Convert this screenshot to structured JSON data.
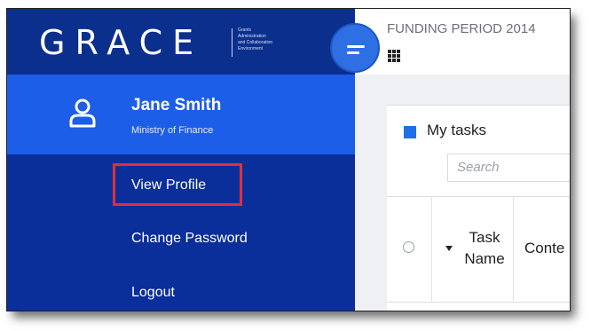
{
  "brand": {
    "name": "GRACE",
    "tagline": "Grants\nAdministration\nand Collaboration\nEnvironment"
  },
  "header": {
    "funding_period": "FUNDING PERIOD 2014",
    "menu_icon": "hamburger-icon",
    "apps_icon": "grid-icon"
  },
  "user": {
    "name": "Jane Smith",
    "organization": "Ministry of Finance",
    "icon": "user-icon"
  },
  "user_menu": {
    "items": [
      {
        "label": "View Profile",
        "highlighted": true
      },
      {
        "label": "Change Password"
      },
      {
        "label": "Logout"
      }
    ]
  },
  "tasks_panel": {
    "title": "My tasks",
    "search_placeholder": "Search",
    "columns": [
      "Task Name",
      "Conte"
    ]
  },
  "colors": {
    "sidebar": "#0a2e9a",
    "user_panel": "#1d5ee8",
    "menu_button": "#2f6fe4",
    "highlight": "#e0303a",
    "accent": "#1f6fe8"
  }
}
